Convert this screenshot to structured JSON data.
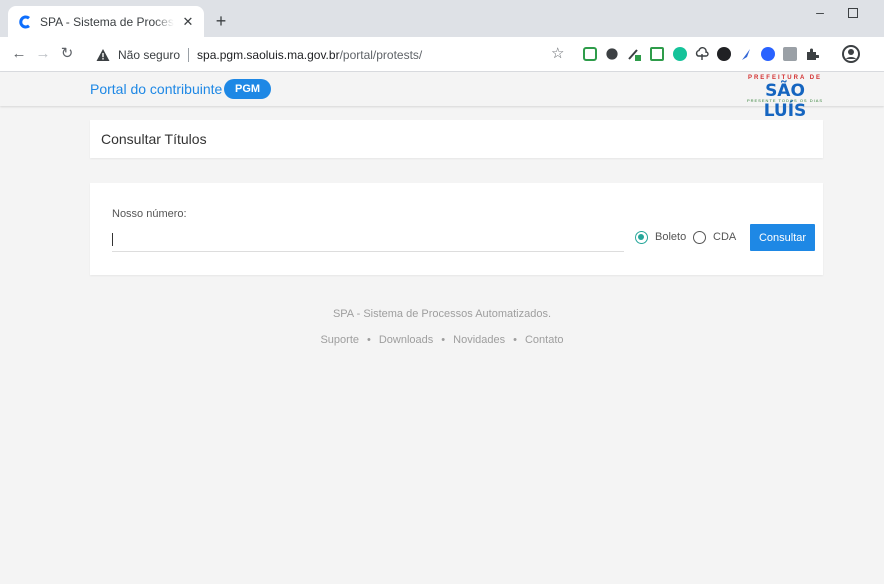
{
  "browser": {
    "tab_title": "SPA - Sistema de Processos Automatizados",
    "tab_close": "✕",
    "new_tab": "+",
    "minimize": "–",
    "security_label": "Não seguro",
    "url_host": "spa.pgm.saoluis.ma.gov.br",
    "url_path": "/portal/protests/",
    "extensions": [
      "evernote-icon",
      "puzzle-ext-icon",
      "pen-ext-icon",
      "form-ext-icon",
      "grammarly-icon",
      "cloud-ext-icon",
      "dark-ext-icon",
      "feather-ext-icon",
      "chat-ext-icon",
      "code-ext-icon",
      "extensions-icon",
      "profile-icon"
    ]
  },
  "header": {
    "portal_title": "Portal do contribuinte",
    "badge": "PGM",
    "logo": {
      "top": "PREFEITURA DE",
      "main": "SÃO LUÍS",
      "bottom": "PRESENTE TODOS OS DIAS"
    }
  },
  "title_card": {
    "title": "Consultar Títulos"
  },
  "form": {
    "label": "Nosso número:",
    "input_value": "",
    "radio_options": [
      {
        "label": "Boleto",
        "checked": true
      },
      {
        "label": "CDA",
        "checked": false
      }
    ],
    "submit_label": "Consultar"
  },
  "footer": {
    "tagline": "SPA - Sistema de Processos Automatizados.",
    "links": [
      "Suporte",
      "Downloads",
      "Novidades",
      "Contato"
    ],
    "separator": "•"
  },
  "colors": {
    "accent": "#1e88e5",
    "radio": "#26a69a",
    "page_bg": "#f4f4f4"
  }
}
